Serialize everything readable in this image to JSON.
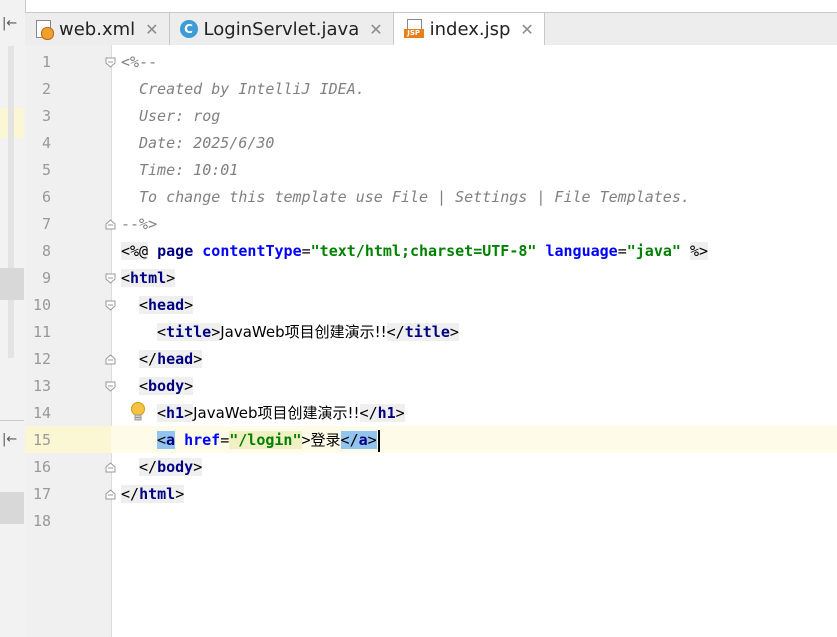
{
  "tabs": [
    {
      "label": "web.xml",
      "icon": "xml-file-icon",
      "active": false
    },
    {
      "label": "LoginServlet.java",
      "icon": "java-class-icon",
      "class_letter": "C",
      "active": false
    },
    {
      "label": "index.jsp",
      "icon": "jsp-file-icon",
      "badge": "JSP",
      "active": true
    }
  ],
  "line_numbers": [
    "1",
    "2",
    "3",
    "4",
    "5",
    "6",
    "7",
    "8",
    "9",
    "10",
    "11",
    "12",
    "13",
    "14",
    "15",
    "16",
    "17",
    "18"
  ],
  "code": {
    "l1": "<%--",
    "l2": "Created by IntelliJ IDEA.",
    "l3": "User: rog",
    "l4": "Date: 2025/6/30",
    "l5": "Time: 10:01",
    "l6": "To change this template use File | Settings | File Templates.",
    "l7": "--%>",
    "l8_open": "<%@",
    "l8_page": "page",
    "l8_attr1": "contentType",
    "l8_val1": "\"text/html;charset=UTF-8\"",
    "l8_attr2": "language",
    "l8_val2": "\"java\"",
    "l8_close": "%>",
    "tag_html": "html",
    "tag_head": "head",
    "tag_title": "title",
    "title_text": "JavaWeb项目创建演示!!",
    "tag_body": "body",
    "tag_h1": "h1",
    "h1_text": "JavaWeb项目创建演示!!",
    "tag_a": "a",
    "a_attr": "href",
    "a_val": "\"/login\"",
    "a_text": "登录"
  }
}
